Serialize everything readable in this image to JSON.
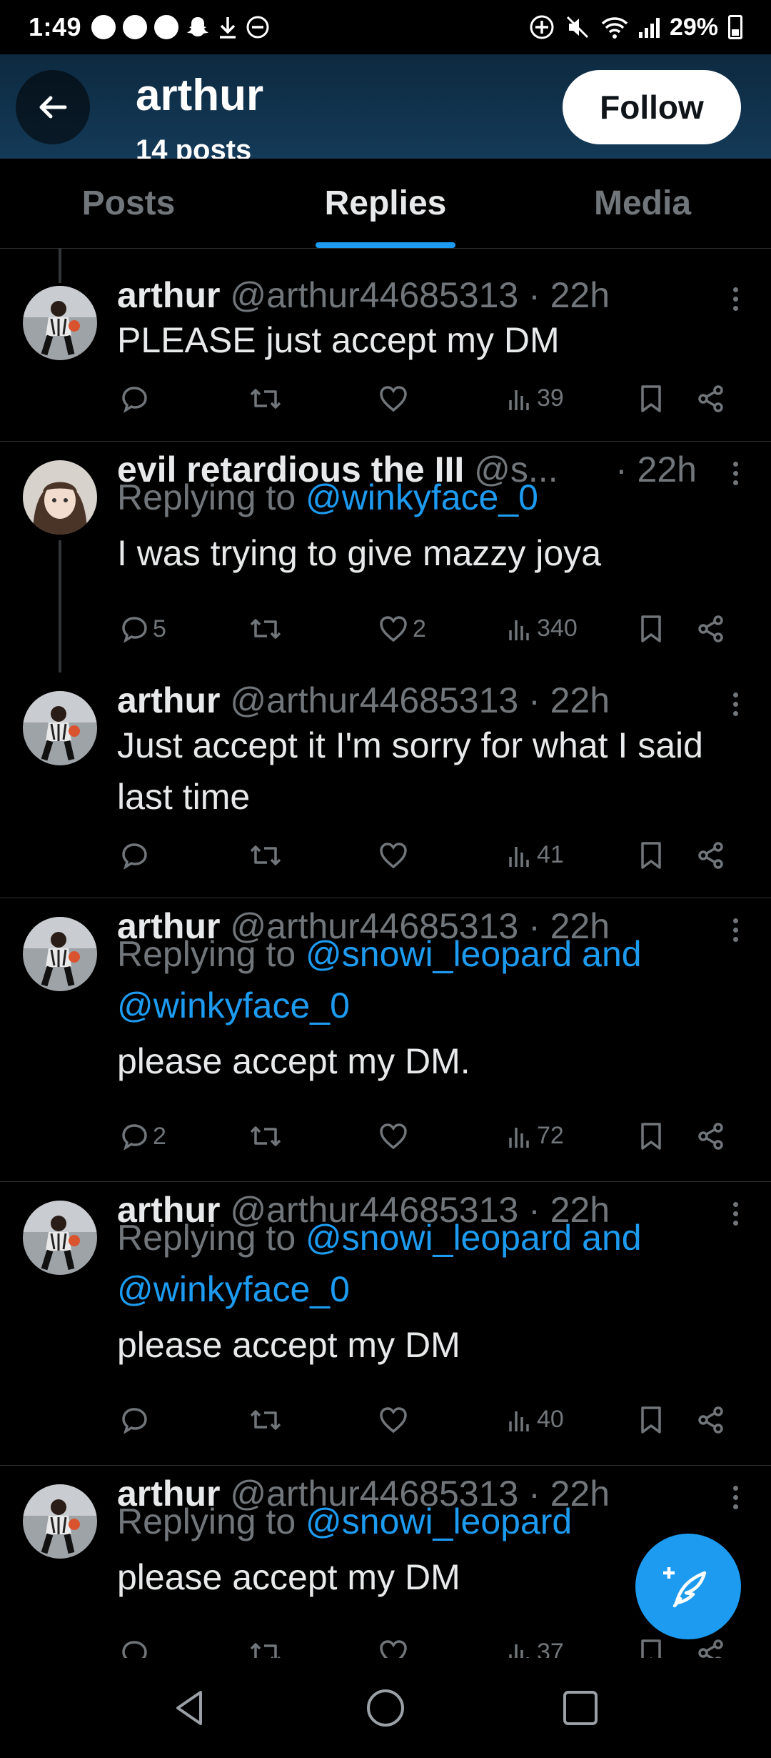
{
  "status_bar": {
    "time": "1:49",
    "battery": "29%",
    "icons_left": [
      "messenger-icon",
      "messenger-icon",
      "messenger-icon",
      "snapchat-icon",
      "download-icon",
      "dnd-icon"
    ],
    "icons_right": [
      "location-icon",
      "mute-icon",
      "wifi-icon",
      "signal-icon",
      "battery-icon"
    ]
  },
  "header": {
    "name": "arthur",
    "subtitle": "14 posts",
    "follow_label": "Follow",
    "back_icon": "arrow-left-icon",
    "background": "#143a58"
  },
  "tabs": [
    {
      "label": "Posts",
      "active": false
    },
    {
      "label": "Replies",
      "active": true
    },
    {
      "label": "Media",
      "active": false
    }
  ],
  "tweets": [
    {
      "name": "arthur",
      "meta": " @arthur44685313 · 22h",
      "text": "PLEASE just accept my DM",
      "replies": "",
      "likes": "",
      "views": "39"
    },
    {
      "name": "evil retardious the III",
      "meta": " @s...",
      "time": "· 22h",
      "reply_prefix": "Replying to ",
      "reply_link": "@winkyface_0",
      "text": "I was trying to give mazzy joya",
      "replies": "5",
      "likes": "2",
      "views": "340"
    },
    {
      "name": "arthur",
      "meta": " @arthur44685313 · 22h",
      "text": "Just accept it I'm sorry for what I said last time",
      "replies": "",
      "likes": "",
      "views": "41"
    },
    {
      "name": "arthur",
      "meta": " @arthur44685313 · 22h",
      "reply_prefix": "Replying to ",
      "reply_link": "@snowi_leopard and @winkyface_0",
      "text": "please accept my DM.",
      "replies": "2",
      "likes": "",
      "views": "72"
    },
    {
      "name": "arthur",
      "meta": " @arthur44685313 · 22h",
      "reply_prefix": "Replying to ",
      "reply_link": "@snowi_leopard and @winkyface_0",
      "text": "please accept my DM",
      "replies": "",
      "likes": "",
      "views": "40"
    },
    {
      "name": "arthur",
      "meta": " @arthur44685313 · 22h",
      "reply_prefix": "Replying to ",
      "reply_link": "@snowi_leopard",
      "text": "please accept my DM",
      "replies": "",
      "likes": "",
      "views": "37"
    }
  ],
  "fab_icon": "compose-post-icon",
  "accent": "#1d9bf0"
}
